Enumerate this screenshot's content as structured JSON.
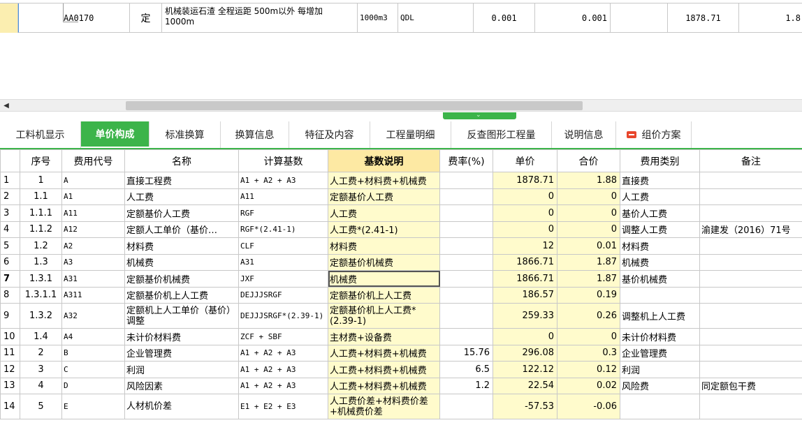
{
  "top_row": {
    "code": "AA0170",
    "type": "定",
    "name": "机械装运石渣 全程运距 500m以外 每增加 1000m",
    "unit": "1000m3",
    "qty_expr": "QDL",
    "qty1": "0.001",
    "qty2": "0.001",
    "price": "1878.71",
    "total": "1.8"
  },
  "tabs": [
    {
      "label": "工料机显示"
    },
    {
      "label": "单价构成"
    },
    {
      "label": "标准换算"
    },
    {
      "label": "换算信息"
    },
    {
      "label": "特征及内容"
    },
    {
      "label": "工程量明细"
    },
    {
      "label": "反查图形工程量"
    },
    {
      "label": "说明信息"
    },
    {
      "label": "组价方案"
    }
  ],
  "columns": [
    "序号",
    "费用代号",
    "名称",
    "计算基数",
    "基数说明",
    "费率(%)",
    "单价",
    "合价",
    "费用类别",
    "备注"
  ],
  "rows": [
    {
      "n": "1",
      "seq": "1",
      "code": "A",
      "name": "直接工程费",
      "base": "A1 + A2 + A3",
      "desc": "人工费+材料费+机械费",
      "rate": "",
      "price": "1878.71",
      "total": "1.88",
      "cat": "直接费",
      "note": ""
    },
    {
      "n": "2",
      "seq": "1.1",
      "code": "A1",
      "name": "人工费",
      "base": "A11",
      "desc": "定额基价人工费",
      "rate": "",
      "price": "0",
      "total": "0",
      "cat": "人工费",
      "note": ""
    },
    {
      "n": "3",
      "seq": "1.1.1",
      "code": "A11",
      "name": "定额基价人工费",
      "base": "RGF",
      "desc": "人工费",
      "rate": "",
      "price": "0",
      "total": "0",
      "cat": "基价人工费",
      "note": ""
    },
    {
      "n": "4",
      "seq": "1.1.2",
      "code": "A12",
      "name": "定额人工单价（基价…",
      "base": "RGF*(2.41-1)",
      "desc": "人工费*(2.41-1)",
      "rate": "",
      "price": "0",
      "total": "0",
      "cat": "调整人工费",
      "note": "渝建发（2016）71号"
    },
    {
      "n": "5",
      "seq": "1.2",
      "code": "A2",
      "name": "材料费",
      "base": "CLF",
      "desc": "材料费",
      "rate": "",
      "price": "12",
      "total": "0.01",
      "cat": "材料费",
      "note": ""
    },
    {
      "n": "6",
      "seq": "1.3",
      "code": "A3",
      "name": "机械费",
      "base": "A31",
      "desc": "定额基价机械费",
      "rate": "",
      "price": "1866.71",
      "total": "1.87",
      "cat": "机械费",
      "note": ""
    },
    {
      "n": "7",
      "seq": "1.3.1",
      "code": "A31",
      "name": "定额基价机械费",
      "base": "JXF",
      "desc": "机械费",
      "rate": "",
      "price": "1866.71",
      "total": "1.87",
      "cat": "基价机械费",
      "note": ""
    },
    {
      "n": "8",
      "seq": "1.3.1.1",
      "code": "A311",
      "name": "定额基价机上人工费",
      "base": "DEJJJSRGF",
      "desc": "定额基价机上人工费",
      "rate": "",
      "price": "186.57",
      "total": "0.19",
      "cat": "",
      "note": ""
    },
    {
      "n": "9",
      "seq": "1.3.2",
      "code": "A32",
      "name": "定额机上人工单价（基价）调整",
      "base": "DEJJJSRGF*(2.39-1)",
      "desc": "定额基价机上人工费*(2.39-1)",
      "rate": "",
      "price": "259.33",
      "total": "0.26",
      "cat": "调整机上人工费",
      "note": ""
    },
    {
      "n": "10",
      "seq": "1.4",
      "code": "A4",
      "name": "未计价材料费",
      "base": "ZCF + SBF",
      "desc": "主材费+设备费",
      "rate": "",
      "price": "0",
      "total": "0",
      "cat": "未计价材料费",
      "note": ""
    },
    {
      "n": "11",
      "seq": "2",
      "code": "B",
      "name": "企业管理费",
      "base": "A1 + A2 + A3",
      "desc": "人工费+材料费+机械费",
      "rate": "15.76",
      "price": "296.08",
      "total": "0.3",
      "cat": "企业管理费",
      "note": ""
    },
    {
      "n": "12",
      "seq": "3",
      "code": "C",
      "name": "利润",
      "base": "A1 + A2 + A3",
      "desc": "人工费+材料费+机械费",
      "rate": "6.5",
      "price": "122.12",
      "total": "0.12",
      "cat": "利润",
      "note": ""
    },
    {
      "n": "13",
      "seq": "4",
      "code": "D",
      "name": "风险因素",
      "base": "A1 + A2 + A3",
      "desc": "人工费+材料费+机械费",
      "rate": "1.2",
      "price": "22.54",
      "total": "0.02",
      "cat": "风险费",
      "note": "同定额包干费"
    },
    {
      "n": "14",
      "seq": "5",
      "code": "E",
      "name": "人材机价差",
      "base": "E1 + E2 + E3",
      "desc": "人工费价差+材料费价差+机械费价差",
      "rate": "",
      "price": "-57.53",
      "total": "-0.06",
      "cat": "",
      "note": ""
    }
  ]
}
